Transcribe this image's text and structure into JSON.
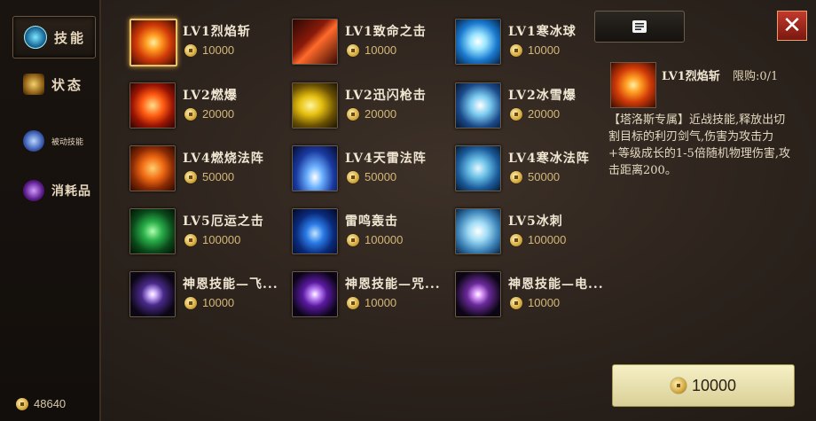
{
  "sidebar": {
    "tabs": [
      {
        "label": "技能",
        "icon": "skill-orb-icon",
        "active": true
      },
      {
        "label": "状态",
        "icon": "status-icon",
        "active": false
      },
      {
        "label": "被动技能",
        "icon": "passive-skill-icon",
        "active": false
      },
      {
        "label": "消耗品",
        "icon": "consumable-icon",
        "active": false
      }
    ],
    "gold": "48640"
  },
  "skills": [
    {
      "name": "LV1烈焰斩",
      "price": "10000",
      "icon": "flame-slash-icon",
      "selected": true
    },
    {
      "name": "LV1致命之击",
      "price": "10000",
      "icon": "fatal-strike-icon"
    },
    {
      "name": "LV1寒冰球",
      "price": "10000",
      "icon": "ice-ball-icon"
    },
    {
      "name": "LV2燃爆",
      "price": "20000",
      "icon": "burn-burst-icon"
    },
    {
      "name": "LV2迅闪枪击",
      "price": "20000",
      "icon": "flash-spear-icon"
    },
    {
      "name": "LV2冰雪爆",
      "price": "20000",
      "icon": "snow-burst-icon"
    },
    {
      "name": "LV4燃烧法阵",
      "price": "50000",
      "icon": "fire-array-icon"
    },
    {
      "name": "LV4天雷法阵",
      "price": "50000",
      "icon": "thunder-array-icon"
    },
    {
      "name": "LV4寒冰法阵",
      "price": "50000",
      "icon": "ice-array-icon"
    },
    {
      "name": "LV5厄运之击",
      "price": "100000",
      "icon": "doom-strike-icon"
    },
    {
      "name": "雷鸣轰击",
      "price": "100000",
      "icon": "thunder-blast-icon"
    },
    {
      "name": "LV5冰刺",
      "price": "100000",
      "icon": "ice-spike-icon"
    },
    {
      "name": "神恩技能—飞...",
      "price": "10000",
      "icon": "divine-skill-icon"
    },
    {
      "name": "神恩技能—咒...",
      "price": "10000",
      "icon": "divine-curse-icon"
    },
    {
      "name": "神恩技能—电...",
      "price": "10000",
      "icon": "divine-electric-icon"
    }
  ],
  "detail": {
    "name": "LV1烈焰斩",
    "limit": "限购:0/1",
    "description": "【塔洛斯专属】近战技能,释放出切割目标的利刃剑气,伤害为攻击力+等级成长的1-5倍随机物理伤害,攻击距离200。",
    "icon": "flame-slash-icon"
  },
  "buy_button": {
    "price": "10000"
  },
  "colors": {
    "gold": "#d4b878",
    "close": "#c3392c",
    "buy": "#f6f0c6"
  }
}
